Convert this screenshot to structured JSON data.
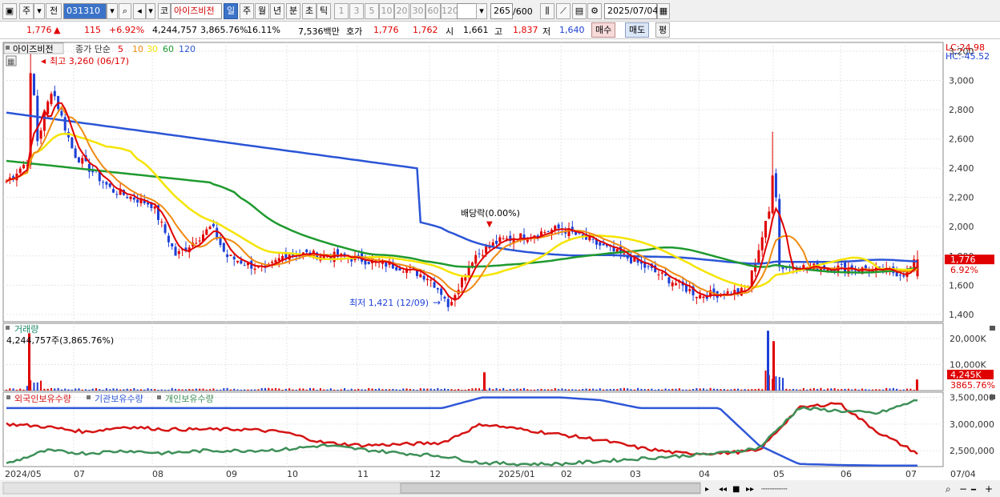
{
  "toolbar": {
    "type_label": "주",
    "type2_label": "전",
    "code": "031310",
    "market_label": "코",
    "stock_name": "아이즈비전",
    "periods": [
      "일",
      "주",
      "월",
      "년",
      "분",
      "초",
      "틱"
    ],
    "active_period": "일",
    "intervals": [
      "1",
      "3",
      "5",
      "10",
      "20",
      "30",
      "60",
      "120"
    ],
    "count": "265",
    "count_total": "/600",
    "date": "2025/07/04"
  },
  "info": {
    "price": "1,776",
    "change": "115",
    "change_pct": "+6.92%",
    "volume": "4,244,757",
    "volume_pct": "3,865.76%",
    "turnover_pct": "16.11%",
    "amount": "7,536백만",
    "ask_label": "호가",
    "ask1": "1,776",
    "ask2": "1,762",
    "open_label": "시",
    "open": "1,661",
    "high_label": "고",
    "high": "1,837",
    "low_label": "저",
    "low": "1,640",
    "buy_label": "매수",
    "sell_label": "매도",
    "avg_label": "평"
  },
  "price_panel": {
    "name": "아이즈비전",
    "ma_label": "종가 단순",
    "ma_periods": [
      "5",
      "10",
      "30",
      "60",
      "120"
    ],
    "lc": "LC:24.98",
    "hc": "HC:-45.52",
    "high_marker": "최고 3,260 (06/17)",
    "low_marker": "최저 1,421 (12/09)",
    "dividend_marker": "배당락(0.00%)",
    "last_price_tag": "1,776",
    "last_pct_tag": "6.92%",
    "y_ticks": [
      "3,200",
      "3,000",
      "2,800",
      "2,600",
      "2,400",
      "2,200",
      "2,000",
      "1,800",
      "1,600",
      "1,400"
    ]
  },
  "volume_panel": {
    "title": "거래량",
    "value_text": "4,244,757주(3,865.76%)",
    "y_ticks": [
      "20,000K",
      "10,000K"
    ],
    "last_tag": "4,245K",
    "last_pct_tag": "3865.76%"
  },
  "holdings_panel": {
    "series_labels": [
      "외국인보유수량",
      "기관보유수량",
      "개인보유수량"
    ],
    "y_ticks": [
      "3,500,000",
      "3,000,000",
      "2,500,000"
    ]
  },
  "x_labels": [
    "2024/05",
    "07",
    "08",
    "09",
    "10",
    "11",
    "12",
    "2025/01",
    "02",
    "03",
    "04",
    "05",
    "06",
    "07",
    "07/04"
  ],
  "colors": {
    "ma5": "#e00000",
    "ma10": "#f08a10",
    "ma30": "#f5e400",
    "ma60": "#1f9a2f",
    "ma120": "#2b55d6",
    "up": "#e00000",
    "down": "#1c3fd6",
    "foreign": "#d51414",
    "institution": "#2f57d8",
    "retail": "#3e9058"
  },
  "chart_data": [
    {
      "type": "candlestick",
      "title": "아이즈비전",
      "ylim": [
        1350,
        3260
      ],
      "high_point": {
        "label": "최고",
        "value": 3260,
        "date": "06/17"
      },
      "low_point": {
        "label": "최저",
        "value": 1421,
        "date": "12/09"
      },
      "last": {
        "open": 1661,
        "high": 1837,
        "low": 1640,
        "close": 1776
      },
      "close_series": [
        [
          "2024/05",
          2300
        ],
        [
          "05/20",
          2450
        ],
        [
          "06/05",
          2600
        ],
        [
          "06/17",
          2950
        ],
        [
          "07",
          2500
        ],
        [
          "07/15",
          2250
        ],
        [
          "08",
          2150
        ],
        [
          "08/10",
          1800
        ],
        [
          "08/25",
          2000
        ],
        [
          "09",
          1800
        ],
        [
          "09/20",
          1700
        ],
        [
          "10",
          1820
        ],
        [
          "10/20",
          1800
        ],
        [
          "11",
          1780
        ],
        [
          "11/20",
          1720
        ],
        [
          "12",
          1650
        ],
        [
          "12/09",
          1480
        ],
        [
          "12/20",
          1800
        ],
        [
          "2025/01",
          1900
        ],
        [
          "02",
          1990
        ],
        [
          "03",
          1780
        ],
        [
          "03/20",
          1620
        ],
        [
          "04",
          1530
        ],
        [
          "04/20",
          1560
        ],
        [
          "05",
          2200
        ],
        [
          "05/10",
          1800
        ],
        [
          "06",
          1720
        ],
        [
          "07",
          1680
        ],
        [
          "07/04",
          1776
        ]
      ]
    },
    {
      "type": "bar",
      "title": "거래량",
      "last_value": 4244757,
      "peaks": [
        [
          "06/17",
          22000000
        ],
        [
          "05",
          23000000
        ],
        [
          "12/20",
          7000000
        ]
      ],
      "ylim": [
        0,
        24000000
      ]
    },
    {
      "type": "line",
      "series": [
        {
          "name": "외국인보유수량",
          "values": [
            3000000,
            2950000,
            2850000,
            2950000,
            2900000,
            2900000,
            2900000,
            2850000,
            2650000,
            2600000,
            2620000,
            2650000,
            3000000,
            2900000,
            2800000,
            2700000,
            2550000,
            2450000,
            2450000,
            2500000,
            3300000,
            3400000,
            2850000,
            2450000
          ]
        },
        {
          "name": "기관보유수량",
          "values": [
            3300000,
            3300000,
            3300000,
            3300000,
            3300000,
            3300000,
            3300000,
            3300000,
            3300000,
            3300000,
            3300000,
            3300000,
            3500000,
            3500000,
            3500000,
            3450000,
            3300000,
            3300000,
            3300000,
            2600000,
            2250000,
            2230000,
            2220000,
            2220000
          ]
        },
        {
          "name": "개인보유수량",
          "values": [
            2250000,
            2500000,
            2450000,
            2500000,
            2450000,
            2500000,
            2500000,
            2520000,
            2600000,
            2520000,
            2450000,
            2400000,
            2270000,
            2250000,
            2250000,
            2300000,
            2350000,
            2400000,
            2450000,
            2550000,
            3300000,
            3250000,
            3200000,
            3450000
          ]
        }
      ],
      "ylim": [
        2200000,
        3600000
      ]
    }
  ]
}
